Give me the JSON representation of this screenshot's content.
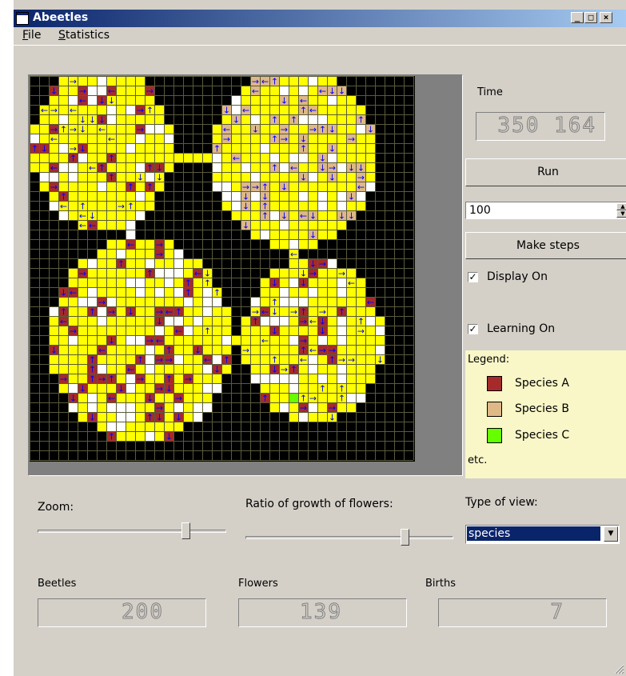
{
  "window": {
    "title": "Abeetles"
  },
  "titlebar_buttons": {
    "minimize": "_",
    "maximize": "□",
    "close": "×"
  },
  "menu": [
    {
      "label": "File",
      "mnemonic": "F",
      "rest": "ile"
    },
    {
      "label": "Statistics",
      "mnemonic": "S",
      "rest": "tatistics"
    }
  ],
  "time": {
    "label": "Time",
    "value": "350 164"
  },
  "run_button": "Run",
  "steps": {
    "value": "100"
  },
  "make_steps_button": "Make steps",
  "display_on": {
    "label": "Display On",
    "checked": true
  },
  "learning_on": {
    "label": "Learning On",
    "checked": true
  },
  "legend": {
    "title": "Legend:",
    "items": [
      {
        "label": "Species A",
        "color": "#a52a2a"
      },
      {
        "label": "Species B",
        "color": "#deb887"
      },
      {
        "label": "Species C",
        "color": "#66ff00"
      }
    ],
    "more": "etc."
  },
  "zoom": {
    "label": "Zoom:",
    "level": 0.8
  },
  "growth": {
    "label": "Ratio of growth of flowers:",
    "level": 0.78
  },
  "view_type": {
    "label": "Type of view:",
    "value": "species"
  },
  "stats": {
    "beetles": {
      "label": "Beetles",
      "value": "200"
    },
    "flowers": {
      "label": "Flowers",
      "value": "139"
    },
    "births": {
      "label": "Births",
      "value": "7"
    }
  },
  "colors": {
    "flower": "#ffff00",
    "empty": "#ffffff",
    "background": "#000000",
    "arrow": "#0000ff"
  }
}
